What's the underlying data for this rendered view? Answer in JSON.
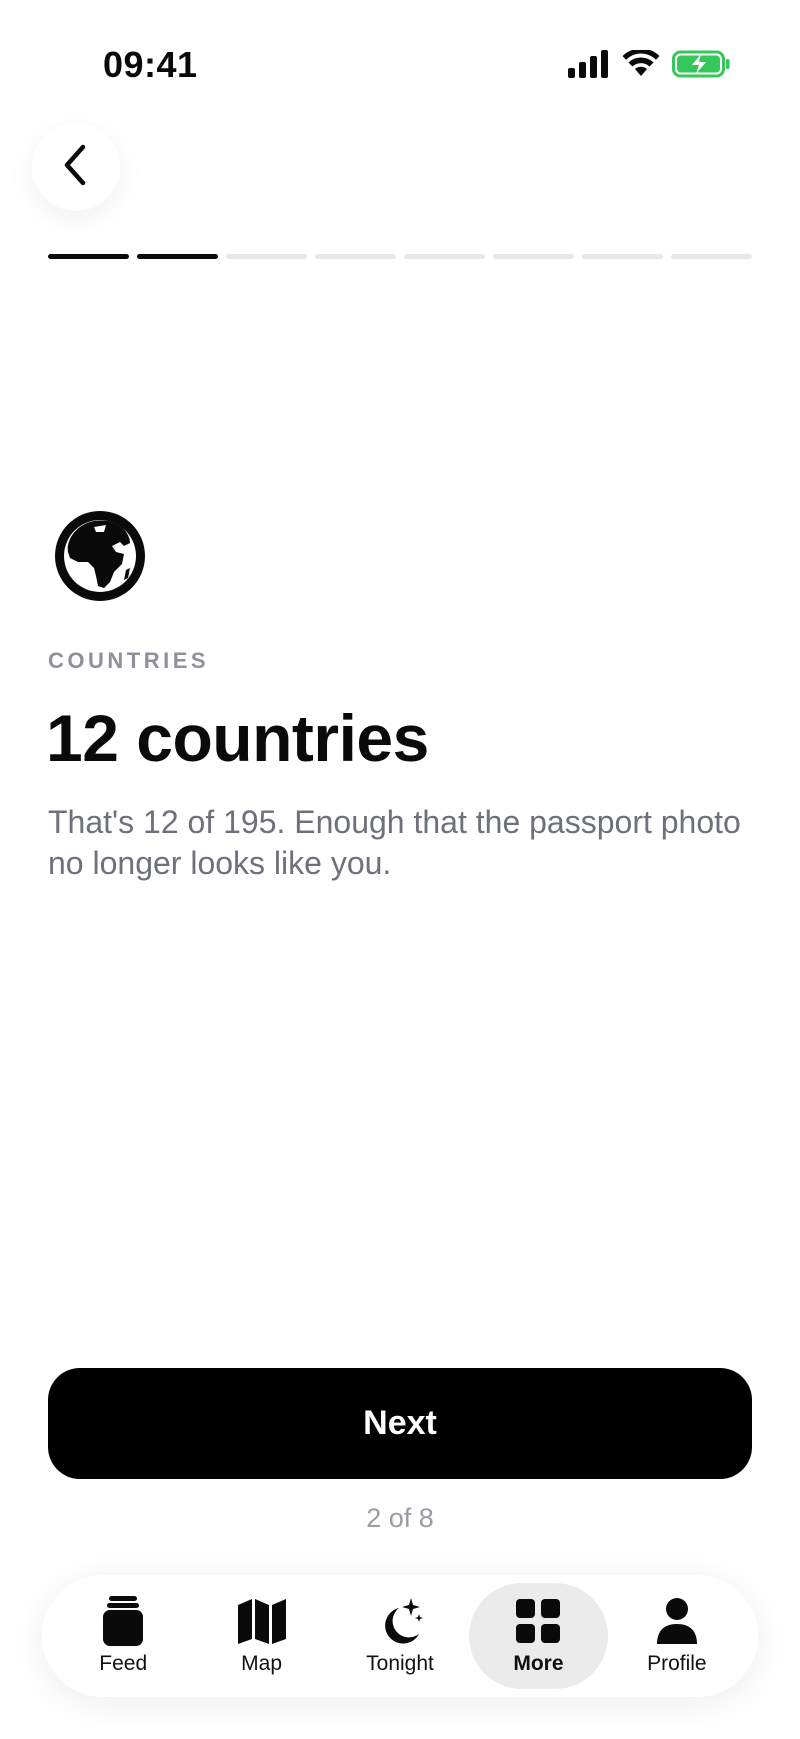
{
  "status_bar": {
    "time": "09:41",
    "icons": [
      "cellular-signal-icon",
      "wifi-icon",
      "battery-charging-icon"
    ],
    "battery_color": "#34c759"
  },
  "nav": {
    "back_icon": "chevron-left-icon"
  },
  "progress": {
    "total_steps": 8,
    "completed_steps": 2,
    "active_color": "#0a0a0a",
    "inactive_color": "#e8e8ea"
  },
  "content": {
    "icon": "globe-africa-icon",
    "eyebrow": "COUNTRIES",
    "headline": "12 countries",
    "body": "That's 12 of 195. Enough that the passport photo no longer looks like you."
  },
  "actions": {
    "next_label": "Next",
    "step_indicator": "2 of 8"
  },
  "tabbar": {
    "items": [
      {
        "label": "Feed",
        "icon": "feed-jar-icon",
        "active": false
      },
      {
        "label": "Map",
        "icon": "map-icon",
        "active": false
      },
      {
        "label": "Tonight",
        "icon": "moon-stars-icon",
        "active": false
      },
      {
        "label": "More",
        "icon": "grid-icon",
        "active": true
      },
      {
        "label": "Profile",
        "icon": "person-icon",
        "active": false
      }
    ]
  }
}
